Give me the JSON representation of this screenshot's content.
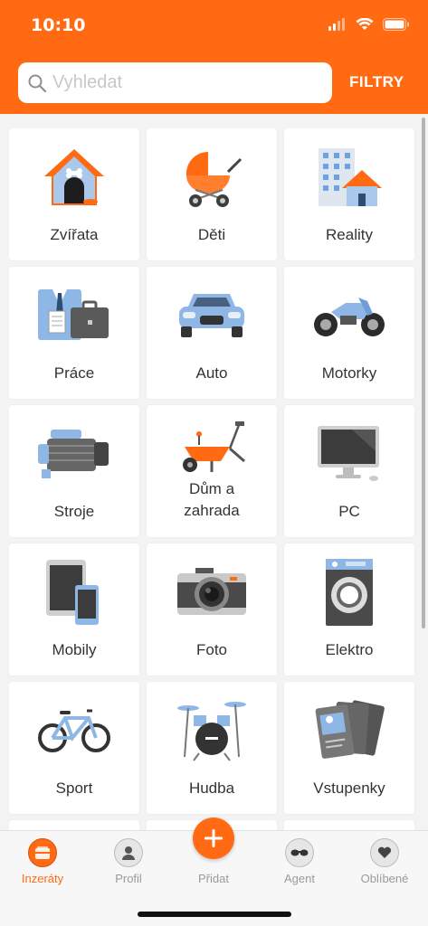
{
  "status": {
    "time": "10:10"
  },
  "search": {
    "placeholder": "Vyhledat",
    "value": ""
  },
  "header": {
    "filters_label": "FILTRY"
  },
  "categories": [
    {
      "label": "Zvířata",
      "icon": "doghouse-icon"
    },
    {
      "label": "Děti",
      "icon": "stroller-icon"
    },
    {
      "label": "Reality",
      "icon": "building-house-icon"
    },
    {
      "label": "Práce",
      "icon": "suit-briefcase-icon"
    },
    {
      "label": "Auto",
      "icon": "car-icon"
    },
    {
      "label": "Motorky",
      "icon": "motorcycle-icon"
    },
    {
      "label": "Stroje",
      "icon": "engine-icon"
    },
    {
      "label_line1": "Dům a",
      "label_line2": "zahrada",
      "icon": "wheelbarrow-icon"
    },
    {
      "label": "PC",
      "icon": "computer-icon"
    },
    {
      "label": "Mobily",
      "icon": "tablet-phone-icon"
    },
    {
      "label": "Foto",
      "icon": "camera-icon"
    },
    {
      "label": "Elektro",
      "icon": "washing-machine-icon"
    },
    {
      "label": "Sport",
      "icon": "bicycle-icon"
    },
    {
      "label": "Hudba",
      "icon": "drums-icon"
    },
    {
      "label": "Vstupenky",
      "icon": "tickets-icon"
    }
  ],
  "tabbar": {
    "items": [
      {
        "label": "Inzeráty",
        "icon": "listings-icon",
        "active": true
      },
      {
        "label": "Profil",
        "icon": "profile-icon",
        "active": false
      },
      {
        "label": "Přidat",
        "icon": "plus-icon",
        "active": false
      },
      {
        "label": "Agent",
        "icon": "agent-glasses-icon",
        "active": false
      },
      {
        "label": "Oblíbené",
        "icon": "heart-icon",
        "active": false
      }
    ]
  },
  "colors": {
    "accent": "#ff6a13",
    "label": "#333333",
    "tab_inactive": "#9a9a9a"
  }
}
